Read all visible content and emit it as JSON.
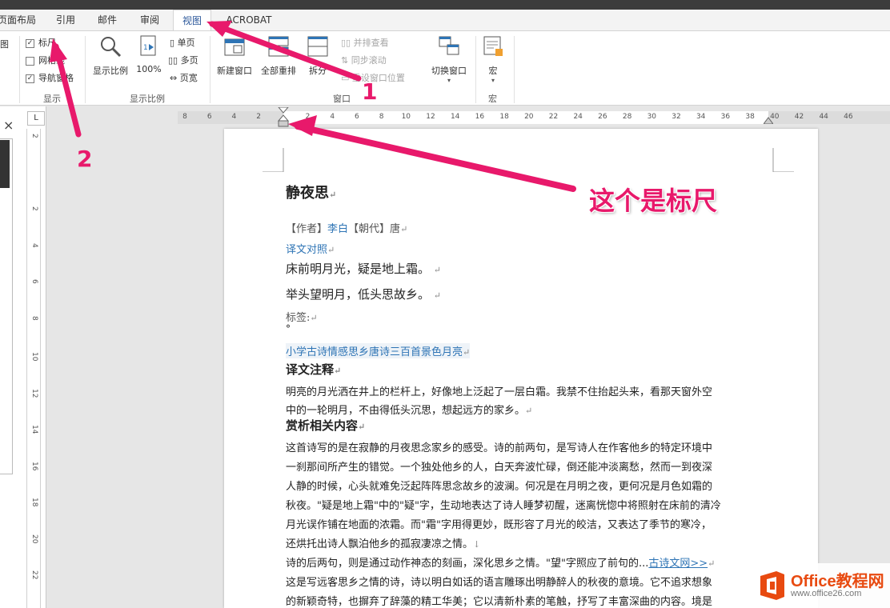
{
  "tabs": [
    {
      "label": "页面布局"
    },
    {
      "label": "引用"
    },
    {
      "label": "邮件"
    },
    {
      "label": "审阅"
    },
    {
      "label": "视图"
    },
    {
      "label": "ACROBAT"
    }
  ],
  "ribbon": {
    "left_cut": "图",
    "show_group": {
      "label": "显示",
      "items": [
        {
          "label": "标尺",
          "checked": true
        },
        {
          "label": "网格线",
          "checked": false
        },
        {
          "label": "导航窗格",
          "checked": true
        }
      ]
    },
    "zoom_group": {
      "label": "显示比例",
      "zoom_btn": "显示比例",
      "pct_btn": "100%",
      "single": "单页",
      "multi": "多页",
      "width": "页宽"
    },
    "window_group": {
      "label": "窗口",
      "new_window": "新建窗口",
      "arrange_all": "全部重排",
      "split": "拆分",
      "side_by_side": "并排查看",
      "sync_scroll": "同步滚动",
      "reset_pos": "重设窗口位置",
      "switch": "切换窗口"
    },
    "macro_group": {
      "label": "宏",
      "btn": "宏"
    }
  },
  "navpane": {
    "close": "×"
  },
  "ruler": {
    "ticks": [
      "8",
      "6",
      "4",
      "2",
      "",
      "2",
      "4",
      "6",
      "8",
      "10",
      "12",
      "14",
      "16",
      "18",
      "20",
      "22",
      "24",
      "26",
      "28",
      "30",
      "32",
      "34",
      "36",
      "38",
      "40",
      "42",
      "44",
      "46"
    ],
    "vticks": [
      "2",
      "",
      "2",
      "4",
      "6",
      "8",
      "10",
      "12",
      "14",
      "16",
      "18",
      "20",
      "22"
    ]
  },
  "document": {
    "title": "静夜思",
    "meta_author_label": "【作者】",
    "meta_author": "李白",
    "meta_dynasty_label": "【朝代】",
    "meta_dynasty": "唐",
    "translate_link": "译文对照",
    "line1": "床前明月光，疑是地上霜。",
    "line2": "举头望明月，低头思故乡。",
    "tags_label": "标签:",
    "dot": "°",
    "tags_links": "小学古诗情感思乡唐诗三百首景色月亮",
    "section1": "译文注释",
    "p1a": "明亮的月光洒在井上的栏杆上，好像地上泛起了一层白霜。我禁不住抬起头来，看那天窗外空",
    "p1b": "中的一轮明月，不由得低头沉思，想起远方的家乡。",
    "section2": "赏析相关内容",
    "p2a": "这首诗写的是在寂静的月夜思念家乡的感受。诗的前两句，是写诗人在作客他乡的特定环境中",
    "p2b": "一刹那间所产生的错觉。一个独处他乡的人，白天奔波忙碌，倒还能冲淡离愁，然而一到夜深",
    "p2c": "人静的时候，心头就难免泛起阵阵思念故乡的波澜。何况是在月明之夜，更何况是月色如霜的",
    "p2d": "秋夜。\"疑是地上霜\"中的\"疑\"字，生动地表达了诗人睡梦初醒，迷离恍惚中将照射在床前的清冷",
    "p2e": "月光误作铺在地面的浓霜。而\"霜\"字用得更妙，既形容了月光的皎洁，又表达了季节的寒冷，",
    "p2f": "还烘托出诗人飘泊他乡的孤寂凄凉之情。",
    "p3a": "诗的后两句，则是通过动作神态的刻画，深化思乡之情。\"望\"字照应了前句的...",
    "p3a_link": "古诗文网>>",
    "p3b": "这是写远客思乡之情的诗，诗以明白如话的语言雕琢出明静醉人的秋夜的意境。它不追求想象",
    "p3c": "的新颖奇特，也摒弃了辞藻的精工华美；它以清新朴素的笔触，抒写了丰富深曲的内容。境是"
  },
  "annotations": {
    "num1": "1",
    "num2": "2",
    "ruler_note": "这个是标尺",
    "color": "#e8196b"
  },
  "watermark": {
    "title": "Office教程网",
    "url": "www.office26.com"
  },
  "colors": {
    "accent": "#2b579a",
    "link": "#2e74b5",
    "annotation": "#e8196b",
    "brand": "#e84a10"
  }
}
